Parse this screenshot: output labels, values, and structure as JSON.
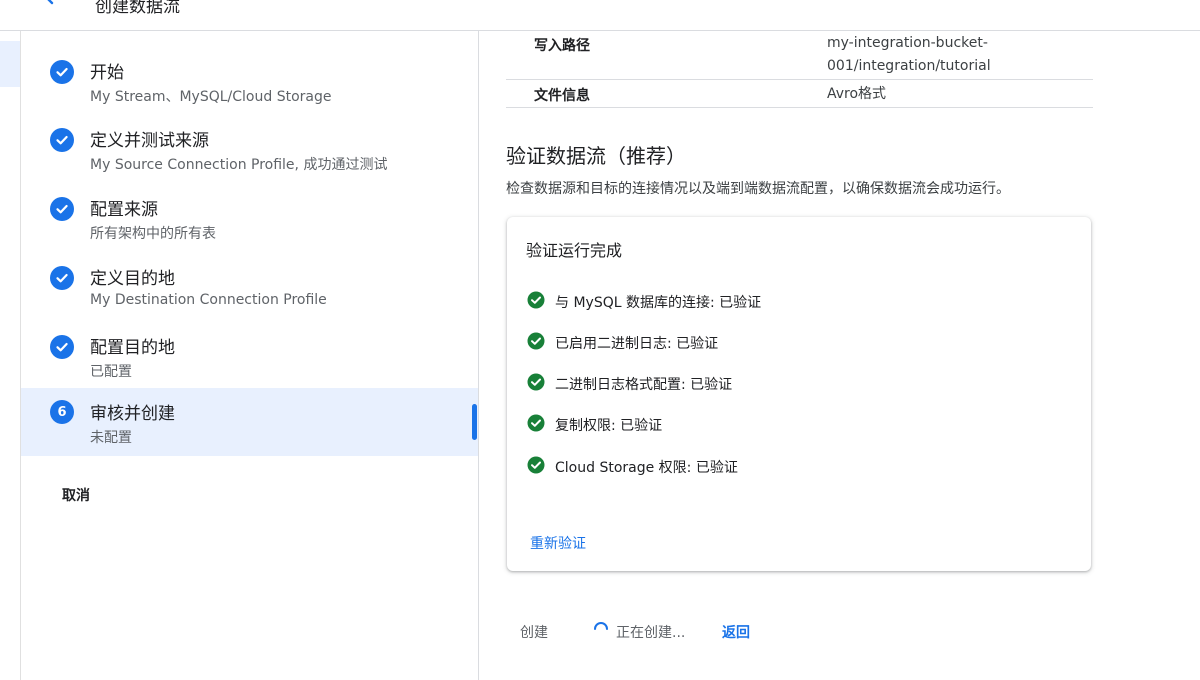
{
  "header": {
    "title": "创建数据流"
  },
  "steps": [
    {
      "number": "",
      "title": "开始",
      "subtitle": "My Stream、MySQL/Cloud Storage",
      "state": "done"
    },
    {
      "number": "",
      "title": "定义并测试来源",
      "subtitle": "My Source Connection Profile, 成功通过测试",
      "state": "done"
    },
    {
      "number": "",
      "title": "配置来源",
      "subtitle": "所有架构中的所有表",
      "state": "done"
    },
    {
      "number": "",
      "title": "定义目的地",
      "subtitle": "My Destination Connection Profile",
      "state": "done"
    },
    {
      "number": "",
      "title": "配置目的地",
      "subtitle": "已配置",
      "state": "done"
    },
    {
      "number": "6",
      "title": "审核并创建",
      "subtitle": "未配置",
      "state": "active"
    }
  ],
  "cancel_label": "取消",
  "summary": {
    "rows": [
      {
        "label": "写入路径",
        "value": "my-integration-bucket-001/integration/tutorial"
      },
      {
        "label": "文件信息",
        "value": "Avro格式"
      }
    ]
  },
  "validation": {
    "title": "验证数据流（推荐）",
    "description": "检查数据源和目标的连接情况以及端到端数据流配置，以确保数据流会成功运行。",
    "card_title": "验证运行完成",
    "checks": [
      "与 MySQL 数据库的连接: 已验证",
      "已启用二进制日志: 已验证",
      "二进制日志格式配置: 已验证",
      "复制权限: 已验证",
      "Cloud Storage 权限: 已验证"
    ],
    "revalidate_label": "重新验证"
  },
  "actions": {
    "create_label": "创建",
    "creating_label": "正在创建...",
    "back_label": "返回"
  },
  "colors": {
    "accent": "#1a73e8",
    "success": "#188038",
    "active_bg": "#e8f0fe"
  }
}
